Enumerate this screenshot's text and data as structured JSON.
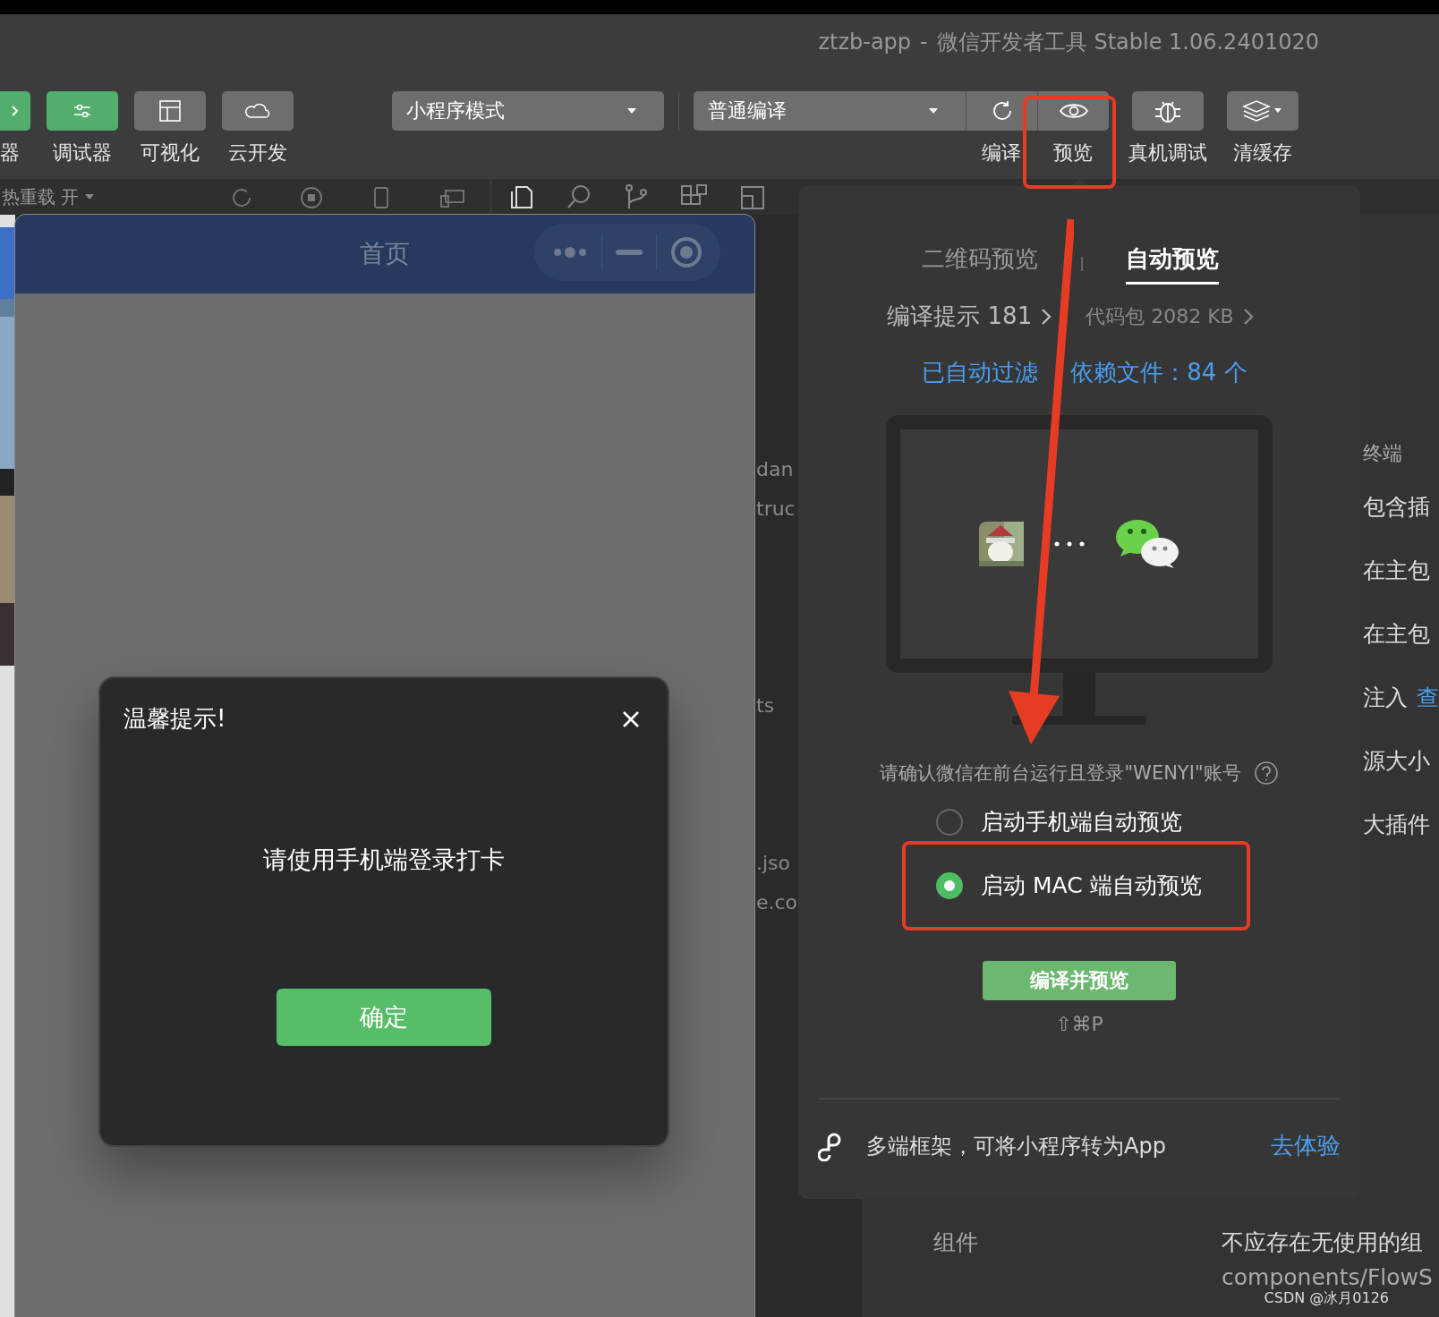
{
  "window": {
    "title": "ztzb-app",
    "separator": "-",
    "subtitle": "微信开发者工具 Stable 1.06.2401020"
  },
  "toolbar": {
    "tools": [
      {
        "label": "器",
        "kind": "partial",
        "color": "#52ae6c"
      },
      {
        "label": "调试器",
        "kind": "sliders",
        "color": "#52ae6c"
      },
      {
        "label": "可视化",
        "kind": "layout",
        "color": "#6e6e6e"
      },
      {
        "label": "云开发",
        "kind": "cloud",
        "color": "#6e6e6e"
      }
    ],
    "mode_select": {
      "value": "小程序模式"
    },
    "compile_select": {
      "value": "普通编译"
    },
    "actions": [
      {
        "label": "编译",
        "kind": "refresh"
      },
      {
        "label": "预览",
        "kind": "eye"
      },
      {
        "label": "真机调试",
        "kind": "bug"
      },
      {
        "label": "清缓存",
        "kind": "layers"
      }
    ]
  },
  "subbar": {
    "hot_reload": "热重载 开"
  },
  "simulator": {
    "page_title": "首页",
    "dialog": {
      "title": "温馨提示!",
      "message": "请使用手机端登录打卡",
      "confirm": "确定"
    }
  },
  "editor_fragments": [
    "dan",
    "truc",
    "ts",
    ".jso",
    "e.co"
  ],
  "right_panel": {
    "tab": "终端",
    "lines": [
      {
        "text": "包含插"
      },
      {
        "text": "在主包"
      },
      {
        "text": "在主包"
      },
      {
        "text": "注入",
        "link": "查"
      },
      {
        "text": "源大小"
      },
      {
        "text": "大插件"
      }
    ],
    "row_label": "组件",
    "row_value": "不应存在无使用的组",
    "row_path": "components/FlowS"
  },
  "preview_popover": {
    "tabs": [
      {
        "label": "二维码预览",
        "selected": false
      },
      {
        "label": "自动预览",
        "selected": true
      }
    ],
    "compile_hints": "编译提示 181",
    "package_size": "代码包 2082 KB",
    "filtered_notice": [
      "已自动过滤",
      "依赖文件：84 个"
    ],
    "login_hint": "请确认微信在前台运行且登录\"WENYI\"账号",
    "options": [
      {
        "label": "启动手机端自动预览",
        "selected": false
      },
      {
        "label": "启动 MAC 端自动预览",
        "selected": true
      }
    ],
    "primary_button": "编译并预览",
    "shortcut": "⇧⌘P",
    "footer": {
      "text": "多端框架，可将小程序转为App",
      "link": "去体验"
    }
  },
  "watermark_credit": "CSDN @冰月0126"
}
